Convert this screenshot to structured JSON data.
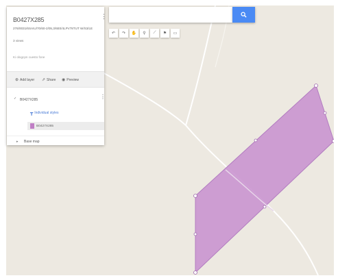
{
  "map": {
    "background": "#ede9e1",
    "polygon_fill": "#c892cf",
    "polygon_stroke": "#b27cc0",
    "road_color": "#ffffff"
  },
  "panel": {
    "title": "B0427X285",
    "subtitle": "276/0031/6SAIU/70/60-2/05,3/6E0/4LPV78TUT W/S3/LE",
    "views": "3 views",
    "description": "Ki ologcpn cuesto fone",
    "toolbar": {
      "add_layer": "Add layer",
      "share": "Share",
      "preview": "Preview"
    },
    "layer": {
      "title": "B0427X285",
      "style_link": "Individual styles",
      "feature_label": "B0427X285"
    },
    "basemap_label": "Base map"
  },
  "search": {
    "value": "",
    "placeholder": ""
  },
  "tools": [
    "undo-icon",
    "redo-icon",
    "hand-icon",
    "marker-icon",
    "line-icon",
    "route-icon",
    "ruler-icon"
  ]
}
